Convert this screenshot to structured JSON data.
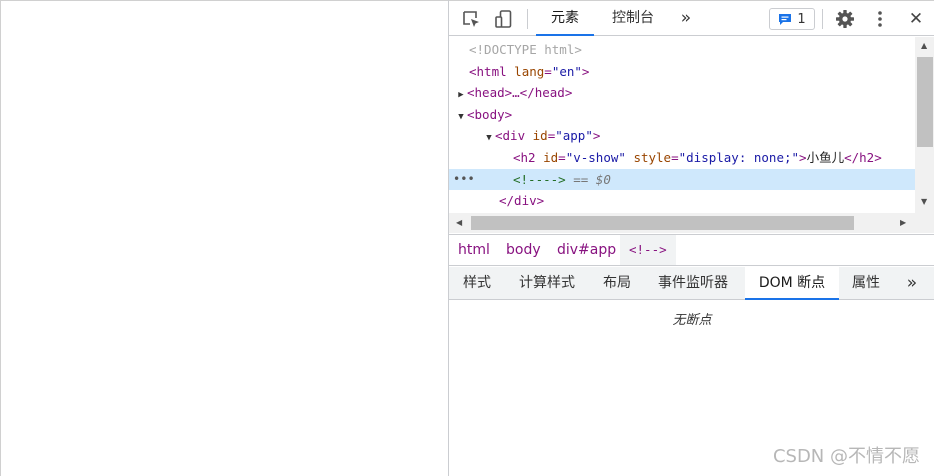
{
  "toolbar": {
    "tabs": [
      {
        "label": "元素",
        "active": true
      },
      {
        "label": "控制台",
        "active": false
      }
    ],
    "more_tabs": "»",
    "issues_count": "1",
    "close": "✕"
  },
  "tree": {
    "doctype": "<!DOCTYPE html>",
    "html_open": "<html",
    "html_attr": "lang",
    "html_val": "\"en\"",
    "head_collapsed": "<head>…</head>",
    "body_open": "<body>",
    "div_open": "<div",
    "div_attr": "id",
    "div_val": "\"app\"",
    "h2_open": "<h2",
    "h2_attr1": "id",
    "h2_val1": "\"v-show\"",
    "h2_attr2": "style",
    "h2_val2": "\"display: none;\"",
    "h2_text": "小鱼儿",
    "h2_close": "</h2>",
    "comment": "<!---->",
    "eq_dollar": "== $0",
    "div_close": "</div>",
    "dots": "•••"
  },
  "breadcrumb": {
    "items": [
      "html",
      "body",
      "div#app",
      "<!-->"
    ]
  },
  "subtabs": {
    "items": [
      "样式",
      "计算样式",
      "布局",
      "事件监听器",
      "DOM 断点",
      "属性"
    ],
    "active_index": 4,
    "more": "»"
  },
  "dom_breakpoints": {
    "empty_text": "无断点"
  },
  "watermark": "CSDN @不情不愿",
  "colors": {
    "accent": "#1a73e8",
    "tag": "#881280",
    "attr_name": "#994500",
    "attr_value": "#1a1aa6",
    "comment": "#236e25",
    "selected_row": "#cfe8fc"
  }
}
